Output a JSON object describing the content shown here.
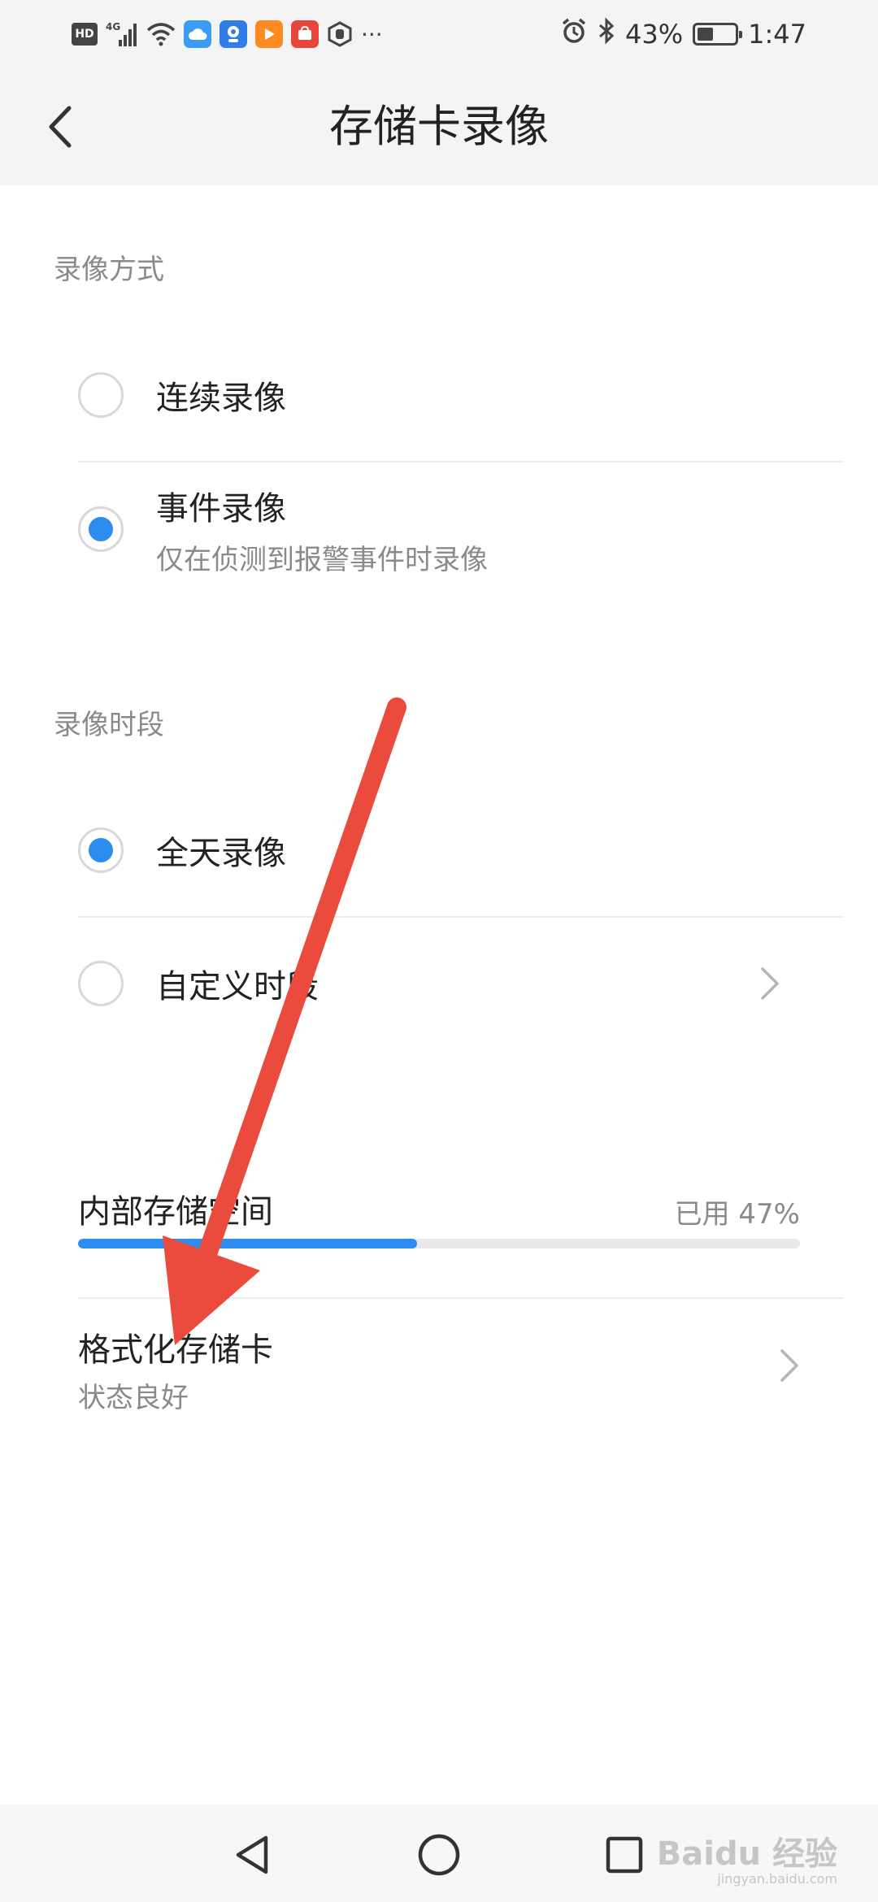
{
  "status_bar": {
    "hd": "HD",
    "network": "4G",
    "more": "···",
    "battery_percent": "43%",
    "battery_level": 0.43,
    "time": "1:47",
    "app_icons": [
      "cloud-icon",
      "camera-app-icon",
      "video-app-icon",
      "huawei-app-icon",
      "hand-app-icon"
    ]
  },
  "header": {
    "title": "存储卡录像"
  },
  "recording_mode": {
    "label": "录像方式",
    "options": [
      {
        "label": "连续录像",
        "sub": "",
        "checked": false
      },
      {
        "label": "事件录像",
        "sub": "仅在侦测到报警事件时录像",
        "checked": true
      }
    ]
  },
  "recording_period": {
    "label": "录像时段",
    "options": [
      {
        "label": "全天录像",
        "checked": true
      },
      {
        "label": "自定义时段",
        "checked": false
      }
    ]
  },
  "storage": {
    "title": "内部存储空间",
    "used_text": "已用 47%",
    "used_fraction": 0.47
  },
  "format": {
    "title": "格式化存储卡",
    "status": "状态良好"
  },
  "watermark": {
    "brand": "Baidu 经验",
    "url": "jingyan.baidu.com"
  },
  "colors": {
    "accent": "#2d8cf0",
    "annotation_arrow": "#ea4b3c"
  }
}
